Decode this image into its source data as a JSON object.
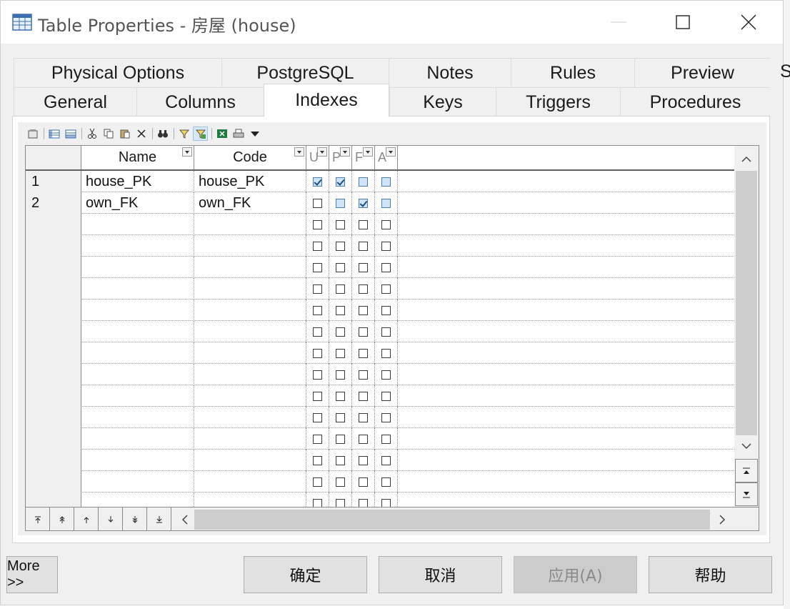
{
  "window": {
    "title": "Table Properties - 房屋 (house)",
    "icon": "table-grid-icon"
  },
  "tabs_row1": [
    "Physical Options",
    "PostgreSQL",
    "Notes",
    "Rules",
    "Preview"
  ],
  "tabs_row2": [
    "General",
    "Columns",
    "Indexes",
    "Keys",
    "Triggers",
    "Procedures"
  ],
  "active_tab": "Indexes",
  "background_overflow_text": "Sy",
  "toolbar": {
    "icons": [
      "properties-icon",
      "insert-row-icon",
      "add-row-icon",
      "cut-icon",
      "copy-icon",
      "paste-icon",
      "delete-icon",
      "find-icon",
      "filter-icon",
      "customize-columns-icon",
      "excel-export-icon",
      "print-icon",
      "dropdown-arrow-icon"
    ],
    "pressed": "customize-columns-icon"
  },
  "grid": {
    "columns": [
      {
        "label": "",
        "dropdown": false
      },
      {
        "label": "Name",
        "dropdown": true
      },
      {
        "label": "Code",
        "dropdown": true
      },
      {
        "label": "U",
        "dropdown": true
      },
      {
        "label": "P",
        "dropdown": true
      },
      {
        "label": "F",
        "dropdown": true
      },
      {
        "label": "A",
        "dropdown": true
      }
    ],
    "rows": [
      {
        "num": "1",
        "name": "house_PK",
        "code": "house_PK",
        "checks": [
          true,
          true,
          false,
          false
        ],
        "blue": [
          false,
          true,
          true,
          true
        ]
      },
      {
        "num": "2",
        "name": "own_FK",
        "code": "own_FK",
        "checks": [
          false,
          false,
          true,
          false
        ],
        "blue": [
          false,
          true,
          true,
          true
        ]
      }
    ],
    "empty_rows": 14
  },
  "buttons": {
    "more": "More >>",
    "ok": "确定",
    "cancel": "取消",
    "apply": "应用(A)",
    "help": "帮助"
  }
}
